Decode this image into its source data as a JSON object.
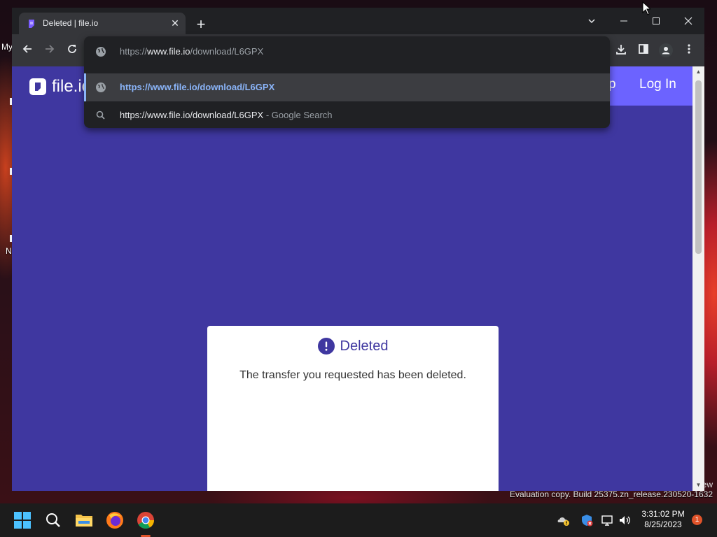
{
  "desktop": {
    "label_my": "My",
    "label_n": "N",
    "watermark_frag": "ew",
    "watermark": "Evaluation copy. Build 25375.zn_release.230520-1632"
  },
  "browser": {
    "tab": {
      "title": "Deleted | file.io",
      "close_icon": "close-icon",
      "favicon_color": "#7a5cff"
    },
    "new_tab_icon": "plus-icon",
    "window_controls": [
      "tab-search-icon",
      "minimize-icon",
      "maximize-icon",
      "close-icon"
    ],
    "toolbar": {
      "back_icon": "arrow-left-icon",
      "forward_icon": "arrow-right-icon",
      "reload_icon": "reload-icon",
      "right_icons": [
        "download-icon",
        "side-panel-icon",
        "profile-icon",
        "more-vert-icon"
      ]
    },
    "omnibox": {
      "input_prefix": "https://",
      "input_host": "www.file.io",
      "input_path": "/download/L6GPX",
      "suggestions": [
        {
          "icon": "globe-icon",
          "text": "https://www.file.io/download/L6GPX",
          "suffix": "",
          "selected": true
        },
        {
          "icon": "search-icon",
          "text": "https://www.file.io/download/L6GPX",
          "suffix": " - Google Search",
          "selected": false
        }
      ]
    }
  },
  "site": {
    "logo_text": "file.io",
    "signup_fragment": "p",
    "login_label": "Log In",
    "brand_color": "#3f37a0",
    "accent_color": "#6c63ff"
  },
  "card": {
    "title": "Deleted",
    "message": "The transfer you requested has been deleted.",
    "icon": "exclamation-circle-icon"
  },
  "taskbar": {
    "apps": [
      "windows-start-icon",
      "search-icon",
      "file-explorer-icon",
      "firefox-icon",
      "chrome-icon"
    ],
    "tray": [
      "onedrive-warning-icon",
      "defender-icon",
      "network-icon",
      "volume-icon"
    ],
    "time": "3:31:02 PM",
    "date": "8/25/2023",
    "notifications": "1"
  }
}
